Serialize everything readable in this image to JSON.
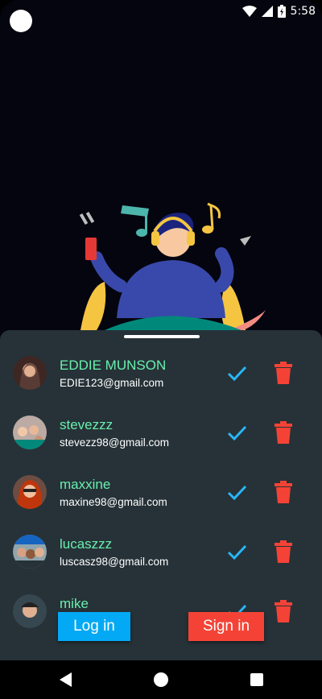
{
  "status_bar": {
    "time": "5:58",
    "icons": [
      "wifi-icon",
      "cellular-signal-icon",
      "battery-charging-icon"
    ]
  },
  "illustration": {
    "description_icon": "person-listening-music-illustration"
  },
  "users": [
    {
      "name": "EDDIE MUNSON",
      "email": "EDIE123@gmail.com",
      "avatar_color": "#5d4037"
    },
    {
      "name": "stevezzz",
      "email": "stevezz98@gmail.com",
      "avatar_color": "#8d6e63"
    },
    {
      "name": "maxxine",
      "email": "maxine98@gmail.com",
      "avatar_color": "#bf360c"
    },
    {
      "name": "lucaszzz",
      "email": "luscasz98@gmail.com",
      "avatar_color": "#455a64"
    },
    {
      "name": "mike",
      "email": "",
      "avatar_color": "#37474f"
    }
  ],
  "buttons": {
    "login_label": "Log in",
    "signin_label": "Sign in"
  },
  "colors": {
    "accent_green": "#69f0ae",
    "check_blue": "#29b6f6",
    "delete_red": "#f44336",
    "sheet_bg": "#263238",
    "login_bg": "#03a9f4",
    "signin_bg": "#f44336"
  }
}
